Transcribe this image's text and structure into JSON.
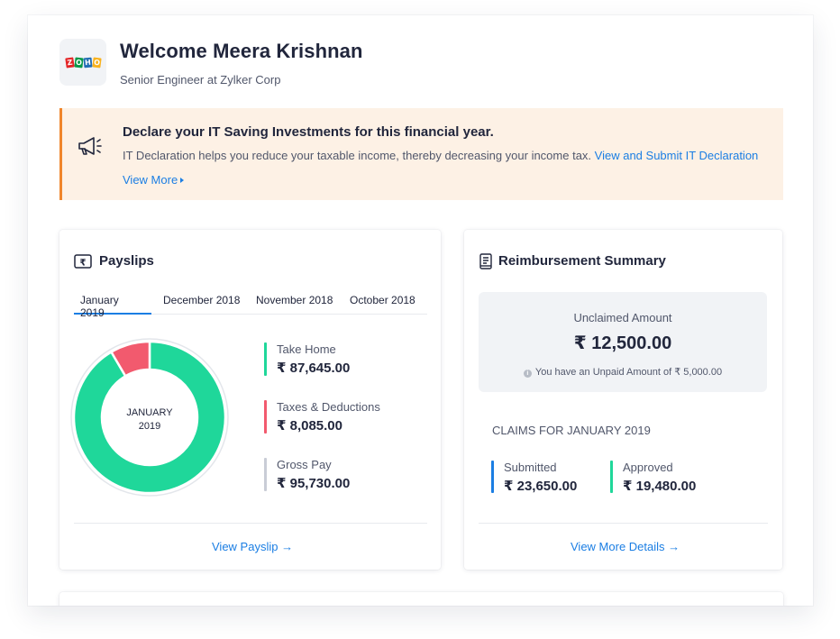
{
  "header": {
    "logo_text": "ZOHO",
    "welcome": "Welcome Meera Krishnan",
    "subtitle": "Senior Engineer at Zylker Corp"
  },
  "banner": {
    "icon": "megaphone-icon",
    "title": "Declare your IT Saving Investments for this financial year.",
    "text": "IT Declaration helps you reduce your taxable income, thereby decreasing your income tax.",
    "link": "View and Submit IT Declaration",
    "more": "View More"
  },
  "payslips": {
    "icon": "rupee-icon",
    "title": "Payslips",
    "tabs": [
      {
        "label": "January 2019",
        "active": true
      },
      {
        "label": "December 2018",
        "active": false
      },
      {
        "label": "November 2018",
        "active": false
      },
      {
        "label": "October 2018",
        "active": false
      }
    ],
    "donut_label_month": "JANUARY",
    "donut_label_year": "2019",
    "stats": [
      {
        "label": "Take Home",
        "value": "₹ 87,645.00",
        "color": "#1fd79a"
      },
      {
        "label": "Taxes & Deductions",
        "value": "₹ 8,085.00",
        "color": "#f25a6e"
      },
      {
        "label": "Gross Pay",
        "value": "₹ 95,730.00",
        "color": "#c9cdd6"
      }
    ],
    "chart": {
      "take_home": 87645,
      "deductions": 8085,
      "colors": {
        "take_home": "#1fd79a",
        "deductions": "#f25a6e"
      }
    },
    "link": "View Payslip →"
  },
  "reimbursement": {
    "icon": "document-icon",
    "title": "Reimbursement Summary",
    "unclaimed_label": "Unclaimed Amount",
    "unclaimed_amount": "₹ 12,500.00",
    "unpaid_text": "You have an Unpaid Amount of ₹ 5,000.00",
    "claims_title": "CLAIMS FOR JANUARY 2019",
    "claims": [
      {
        "label": "Submitted",
        "value": "₹ 23,650.00",
        "color": "#1b7ee3"
      },
      {
        "label": "Approved",
        "value": "₹ 19,480.00",
        "color": "#1fd79a"
      }
    ],
    "link": "View More Details →"
  }
}
